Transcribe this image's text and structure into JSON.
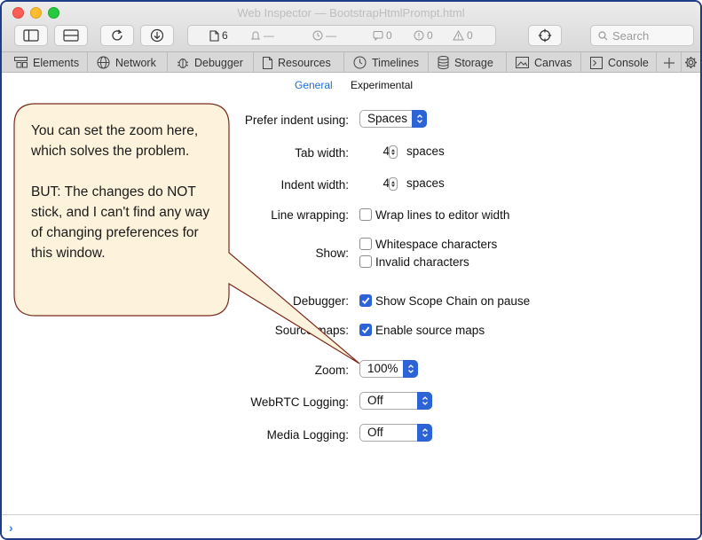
{
  "window": {
    "title": "Web Inspector — BootstrapHtmlPrompt.html"
  },
  "toolbar": {
    "resources_count": "6",
    "requests_dash": "—",
    "time_dash": "—",
    "logs_count": "0",
    "errors_count": "0",
    "warnings_count": "0",
    "search_placeholder": "Search"
  },
  "tabs": [
    {
      "label": "Elements",
      "icon": "elements-icon"
    },
    {
      "label": "Network",
      "icon": "network-icon"
    },
    {
      "label": "Debugger",
      "icon": "debugger-icon"
    },
    {
      "label": "Resources",
      "icon": "resources-icon"
    },
    {
      "label": "Timelines",
      "icon": "timelines-icon"
    },
    {
      "label": "Storage",
      "icon": "storage-icon"
    },
    {
      "label": "Canvas",
      "icon": "canvas-icon"
    },
    {
      "label": "Console",
      "icon": "console-icon"
    }
  ],
  "settings_tabs": {
    "general": "General",
    "experimental": "Experimental"
  },
  "settings": {
    "prefer_indent_label": "Prefer indent using:",
    "prefer_indent_value": "Spaces",
    "tab_width_label": "Tab width:",
    "tab_width_value": "4",
    "indent_width_label": "Indent width:",
    "indent_width_value": "4",
    "spaces_unit": "spaces",
    "line_wrapping_label": "Line wrapping:",
    "wrap_lines_label": "Wrap lines to editor width",
    "wrap_lines_checked": false,
    "show_label": "Show:",
    "whitespace_label": "Whitespace characters",
    "whitespace_checked": false,
    "invalid_label": "Invalid characters",
    "invalid_checked": false,
    "debugger_label": "Debugger:",
    "scope_chain_label": "Show Scope Chain on pause",
    "scope_chain_checked": true,
    "source_maps_label": "Source maps:",
    "source_maps_value_label": "Enable source maps",
    "source_maps_checked": true,
    "zoom_label": "Zoom:",
    "zoom_value": "100%",
    "webrtc_label": "WebRTC Logging:",
    "webrtc_value": "Off",
    "media_label": "Media Logging:",
    "media_value": "Off"
  },
  "callout": {
    "paragraph1": "You can set the zoom here, which solves the problem.",
    "paragraph2": "BUT:  The changes do NOT stick, and I can't find any way of changing preferences for this window."
  },
  "console": {
    "prompt": "›"
  },
  "colors": {
    "accent": "#2c64d6",
    "callout_fill": "#fdf3dc",
    "callout_border": "#7a2a1c",
    "window_border": "#1f3c88"
  }
}
